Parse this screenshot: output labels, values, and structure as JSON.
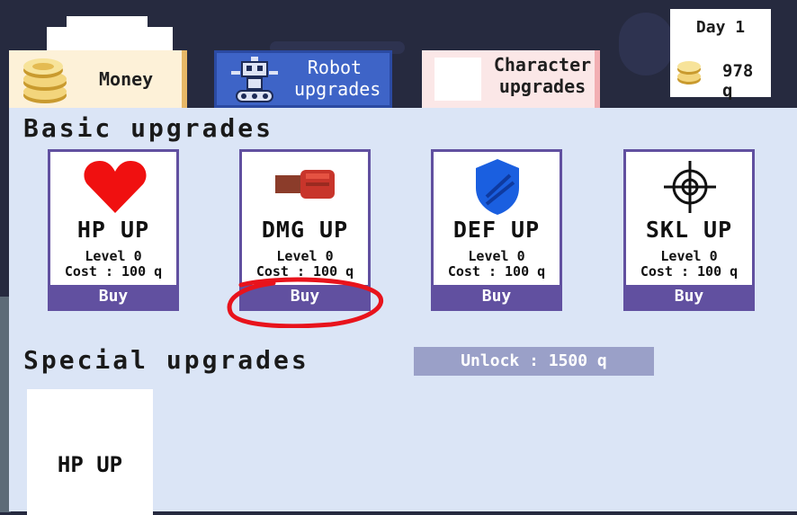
{
  "tabs": {
    "money": {
      "label": "Money",
      "icon": "coin-stack-icon"
    },
    "robot": {
      "label": "Robot upgrades",
      "icon": "robot-icon"
    },
    "character": {
      "label": "Character upgrades"
    }
  },
  "status": {
    "day": "Day 1",
    "money": "978 q",
    "icon": "coin-icon"
  },
  "basic": {
    "title": "Basic upgrades",
    "cards": [
      {
        "name": "HP UP",
        "level": "Level 0",
        "cost": "Cost : 100 q",
        "buy": "Buy",
        "icon": "heart-icon"
      },
      {
        "name": "DMG UP",
        "level": "Level 0",
        "cost": "Cost : 100 q",
        "buy": "Buy",
        "icon": "fist-icon"
      },
      {
        "name": "DEF UP",
        "level": "Level 0",
        "cost": "Cost : 100 q",
        "buy": "Buy",
        "icon": "shield-icon"
      },
      {
        "name": "SKL UP",
        "level": "Level 0",
        "cost": "Cost : 100 q",
        "buy": "Buy",
        "icon": "crosshair-icon"
      }
    ]
  },
  "special": {
    "title": "Special upgrades",
    "unlock": "Unlock : 1500 q",
    "cards": [
      {
        "name": "HP UP"
      }
    ]
  },
  "colors": {
    "panel": "#dbe5f6",
    "accent": "#6150a0",
    "robot_tab": "#3e64c7",
    "annotation": "#e8131c"
  }
}
